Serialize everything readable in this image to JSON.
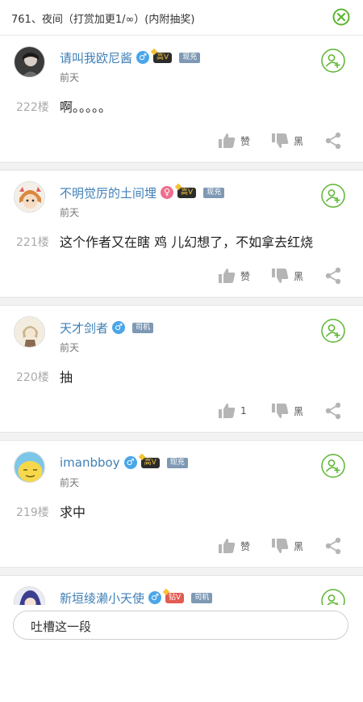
{
  "header": {
    "title": "761、夜间（打赏加更1/∞）(内附抽奖)"
  },
  "comments": [
    {
      "username": "请叫我欧尼酱",
      "gender": "♂",
      "vip": "高V",
      "tag": "现充",
      "time": "前天",
      "floor": "222楼",
      "content": "啊。。。。。",
      "like_label": "赞",
      "dislike_label": "黑"
    },
    {
      "username": "不明觉厉的土间埋",
      "gender": "♀",
      "vip": "高V",
      "tag": "现充",
      "time": "前天",
      "floor": "221楼",
      "content": "这个作者又在瞎  鸡  儿幻想了，不如拿去红烧",
      "like_label": "赞",
      "dislike_label": "黑"
    },
    {
      "username": "天才剑者",
      "gender": "♂",
      "vip": "",
      "tag": "司机",
      "time": "前天",
      "floor": "220楼",
      "content": "抽",
      "like_label": "1",
      "dislike_label": "黑"
    },
    {
      "username": "imanbboy",
      "gender": "♂",
      "vip": "高V",
      "tag": "现充",
      "time": "前天",
      "floor": "219楼",
      "content": "求中",
      "like_label": "赞",
      "dislike_label": "黑"
    },
    {
      "username": "新垣绫濑小天使",
      "gender": "♂",
      "vip": "钻V",
      "tag": "司机",
      "time": "",
      "floor": "",
      "content": "",
      "like_label": "",
      "dislike_label": ""
    }
  ],
  "input": {
    "placeholder": "吐槽这一段"
  },
  "colors": {
    "accent_green": "#5cb531",
    "username_blue": "#3f7fb6"
  }
}
